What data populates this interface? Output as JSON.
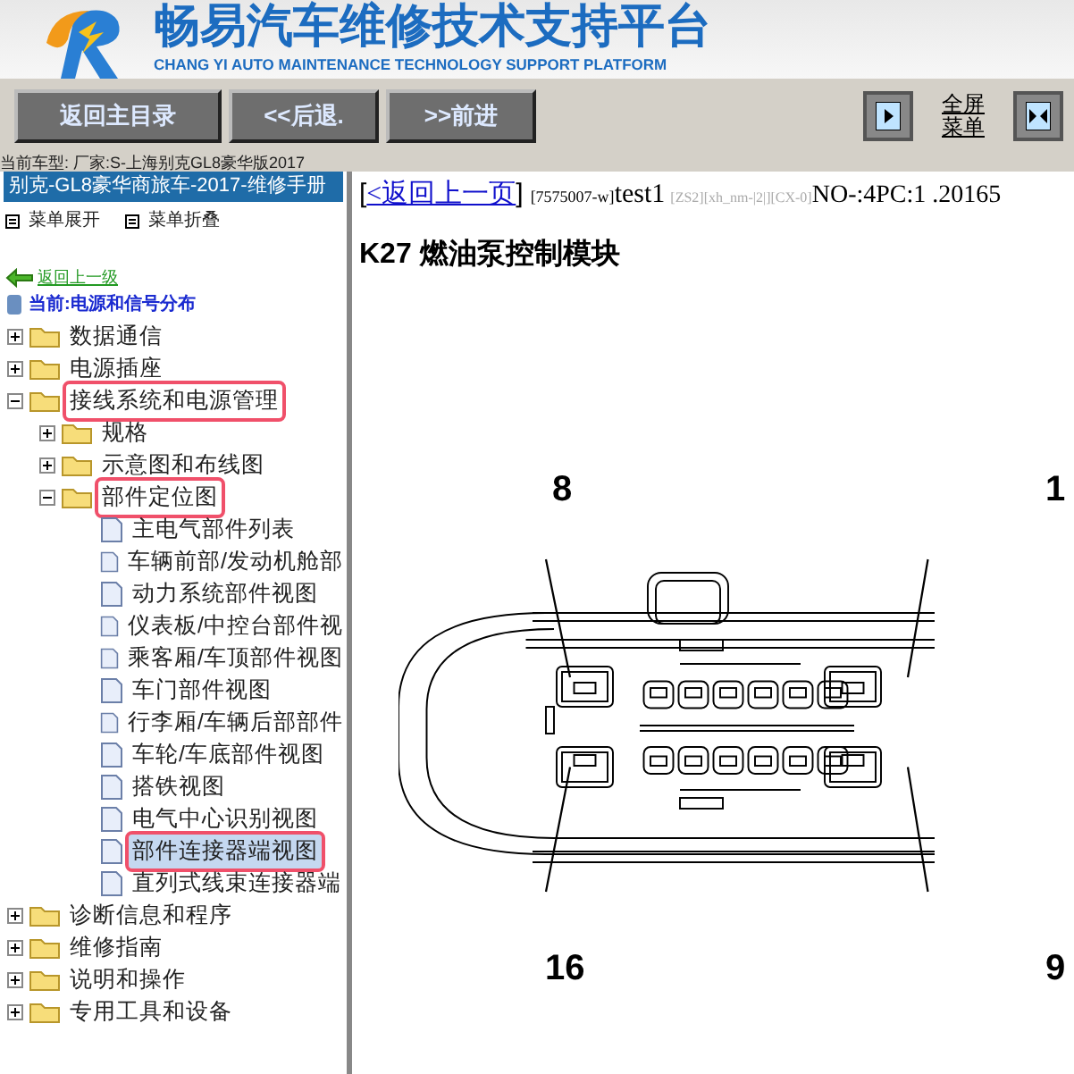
{
  "header": {
    "title": "畅易汽车维修技术支持平台",
    "subtitle": "CHANG YI AUTO MAINTENANCE TECHNOLOGY SUPPORT PLATFORM"
  },
  "toolbar": {
    "buttons": [
      "返回主目录",
      "<<后退.",
      ">>前进"
    ],
    "fullscreen_link": [
      "全屏",
      "菜单"
    ]
  },
  "vehicle_line": "当前车型:  厂家:S-上海别克GL8豪华版2017",
  "sidebar": {
    "manual_title": "别克-GL8豪华商旅车-2017-维修手册",
    "menu_actions": [
      "菜单展开",
      "菜单折叠"
    ],
    "back_link": "返回上一级",
    "current": "当前:电源和信号分布",
    "tree": [
      {
        "kind": "folder",
        "label": "数据通信",
        "expanded": false,
        "marked": false
      },
      {
        "kind": "folder",
        "label": "电源插座",
        "expanded": false,
        "marked": false
      },
      {
        "kind": "folder",
        "label": "接线系统和电源管理",
        "expanded": true,
        "marked": true,
        "children": [
          {
            "kind": "folder",
            "label": "规格",
            "expanded": false,
            "marked": false
          },
          {
            "kind": "folder",
            "label": "示意图和布线图",
            "expanded": false,
            "marked": false
          },
          {
            "kind": "folder",
            "label": "部件定位图",
            "expanded": true,
            "marked": true,
            "children": [
              {
                "kind": "page",
                "label": "主电气部件列表",
                "selected": false,
                "marked": false
              },
              {
                "kind": "page",
                "label": "车辆前部/发动机舱部",
                "selected": false,
                "marked": false
              },
              {
                "kind": "page",
                "label": "动力系统部件视图",
                "selected": false,
                "marked": false
              },
              {
                "kind": "page",
                "label": "仪表板/中控台部件视",
                "selected": false,
                "marked": false
              },
              {
                "kind": "page",
                "label": "乘客厢/车顶部件视图",
                "selected": false,
                "marked": false
              },
              {
                "kind": "page",
                "label": "车门部件视图",
                "selected": false,
                "marked": false
              },
              {
                "kind": "page",
                "label": "行李厢/车辆后部部件",
                "selected": false,
                "marked": false
              },
              {
                "kind": "page",
                "label": "车轮/车底部件视图",
                "selected": false,
                "marked": false
              },
              {
                "kind": "page",
                "label": "搭铁视图",
                "selected": false,
                "marked": false
              },
              {
                "kind": "page",
                "label": "电气中心识别视图",
                "selected": false,
                "marked": false
              },
              {
                "kind": "page",
                "label": "部件连接器端视图",
                "selected": true,
                "marked": true
              },
              {
                "kind": "page",
                "label": "直列式线束连接器端",
                "selected": false,
                "marked": false
              }
            ]
          }
        ]
      },
      {
        "kind": "folder",
        "label": "诊断信息和程序",
        "expanded": false,
        "marked": false
      },
      {
        "kind": "folder",
        "label": "维修指南",
        "expanded": false,
        "marked": false
      },
      {
        "kind": "folder",
        "label": "说明和操作",
        "expanded": false,
        "marked": false
      },
      {
        "kind": "folder",
        "label": "专用工具和设备",
        "expanded": false,
        "marked": false
      }
    ]
  },
  "content": {
    "open_bracket": "[",
    "back_link": "<返回上一页",
    "close_bracket": "]",
    "code": "[7575007-w]",
    "doc_name": "test1",
    "tags": "[ZS2][xh_nm-|2|][CX-0]",
    "number": "NO-:4PC:1 .20165",
    "heading": "K27 燃油泵控制模块",
    "pin_labels": [
      "8",
      "1",
      "16",
      "9"
    ]
  }
}
